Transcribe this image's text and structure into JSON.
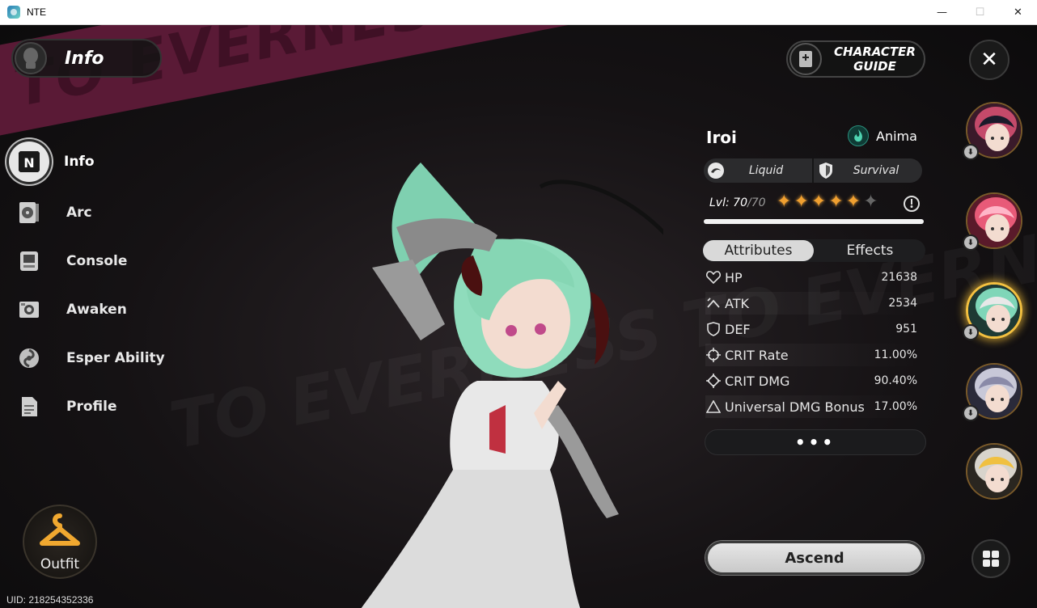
{
  "window": {
    "title": "NTE",
    "minimize_label": "—",
    "maximize_label": "☐",
    "close_label": "✕"
  },
  "background": {
    "banner_text": "TO EVERNESS TO EVERNESS"
  },
  "header": {
    "title": "Info",
    "icon": "mask-icon"
  },
  "menu": {
    "items": [
      {
        "label": "Info",
        "icon": "nte-logo-icon",
        "active": true
      },
      {
        "label": "Arc",
        "icon": "arc-icon",
        "active": false
      },
      {
        "label": "Console",
        "icon": "console-icon",
        "active": false
      },
      {
        "label": "Awaken",
        "icon": "awaken-icon",
        "active": false
      },
      {
        "label": "Esper Ability",
        "icon": "esper-swirl-icon",
        "active": false
      },
      {
        "label": "Profile",
        "icon": "profile-document-icon",
        "active": false
      }
    ]
  },
  "outfit": {
    "label": "Outfit",
    "icon": "hanger-icon"
  },
  "uid": "UID: 218254352336",
  "guide": {
    "label_line1": "CHARACTER",
    "label_line2": "GUIDE",
    "icon": "book-plus-icon"
  },
  "close": {
    "label": "✕"
  },
  "character": {
    "name": "Iroi",
    "element": "Anima",
    "element_icon": "anima-flame-icon",
    "tags": [
      {
        "label": "Liquid",
        "icon": "liquid-swirl-icon"
      },
      {
        "label": "Survival",
        "icon": "shield-icon"
      }
    ],
    "level_prefix": "Lvl:",
    "level": "70",
    "level_max": "/70",
    "stars_filled": 5,
    "stars_total": 6,
    "xp_progress": 1.0
  },
  "tabs": {
    "attributes": "Attributes",
    "effects": "Effects"
  },
  "attributes": [
    {
      "label": "HP",
      "value": "21638",
      "icon": "heart-icon"
    },
    {
      "label": "ATK",
      "value": "2534",
      "icon": "atk-chevron-icon"
    },
    {
      "label": "DEF",
      "value": "951",
      "icon": "def-shield-icon"
    },
    {
      "label": "CRIT Rate",
      "value": "11.00%",
      "icon": "crit-crosshair-icon"
    },
    {
      "label": "CRIT DMG",
      "value": "90.40%",
      "icon": "crit-dmg-crosshair-icon"
    },
    {
      "label": "Universal DMG Bonus",
      "value": "17.00%",
      "icon": "triangle-icon"
    }
  ],
  "more_label": "•••",
  "ascend_label": "Ascend",
  "roster": [
    {
      "name": "character-portrait-1",
      "has_download": true,
      "active": false,
      "colors": [
        "#3a1a2a",
        "#c44a6a",
        "#1a1a2a"
      ]
    },
    {
      "name": "character-portrait-2",
      "has_download": true,
      "active": false,
      "colors": [
        "#5a1a2a",
        "#e85a78",
        "#ffb6c8"
      ]
    },
    {
      "name": "character-portrait-iroi",
      "has_download": true,
      "active": true,
      "colors": [
        "#1e3a34",
        "#7fd6b8",
        "#e8e8e8"
      ]
    },
    {
      "name": "character-portrait-4",
      "has_download": true,
      "active": false,
      "colors": [
        "#2a2a3a",
        "#c8c8d8",
        "#8a8aa8"
      ]
    },
    {
      "name": "character-portrait-5",
      "has_download": false,
      "active": false,
      "colors": [
        "#2a2620",
        "#d8d4cc",
        "#f0c040"
      ]
    }
  ],
  "download_label": "⬇",
  "grid_icon": "grid-icon"
}
